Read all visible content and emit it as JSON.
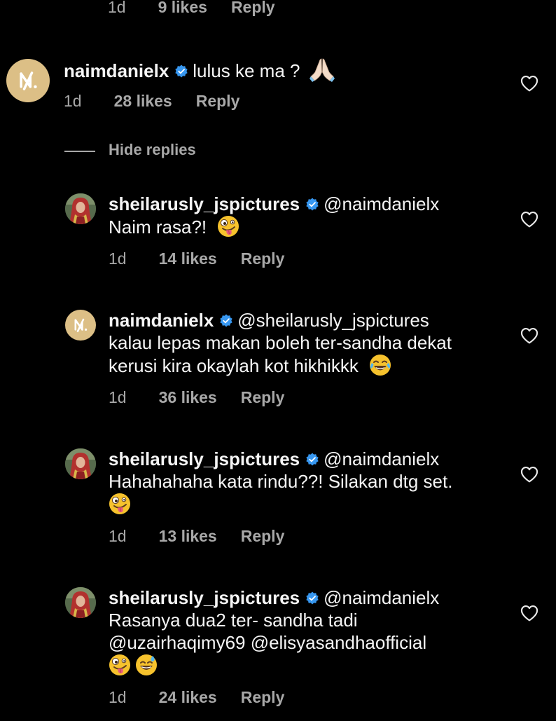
{
  "colors": {
    "background": "#000000",
    "text_primary": "#f5f5f5",
    "text_secondary": "#a8a8a8",
    "verified_badge": "#3797f0",
    "avatar_gold": "#dcbf86"
  },
  "icons": {
    "verified": "verified-badge-icon",
    "like": "heart-outline-icon"
  },
  "top_comment_meta": {
    "time": "1d",
    "likes": "9 likes",
    "reply": "Reply"
  },
  "parent_comment": {
    "username": "naimdanielx",
    "text": "lulus ke ma ?",
    "emoji": "folded-hands",
    "time": "1d",
    "likes": "28 likes",
    "reply": "Reply"
  },
  "hide_replies_label": "Hide replies",
  "replies": [
    {
      "username": "sheilarusly_jspictures",
      "mention": "@naimdanielx",
      "lines": [
        "Naim rasa?!"
      ],
      "time": "1d",
      "likes": "14 likes",
      "reply": "Reply"
    },
    {
      "username": "naimdanielx",
      "mention": "@sheilarusly_jspictures",
      "lines": [
        "kalau lepas makan boleh ter-sandha dekat",
        "kerusi kira okaylah kot hikhikkk"
      ],
      "time": "1d",
      "likes": "36 likes",
      "reply": "Reply"
    },
    {
      "username": "sheilarusly_jspictures",
      "mention": "@naimdanielx",
      "lines": [
        "Hahahahaha kata rindu??! Silakan dtg set."
      ],
      "time": "1d",
      "likes": "13 likes",
      "reply": "Reply"
    },
    {
      "username": "sheilarusly_jspictures",
      "mention": "@naimdanielx",
      "lines": [
        "Rasanya dua2 ter- sandha tadi",
        "@uzairhaqimy69 @elisyasandhaofficial"
      ],
      "time": "1d",
      "likes": "24 likes",
      "reply": "Reply"
    }
  ]
}
